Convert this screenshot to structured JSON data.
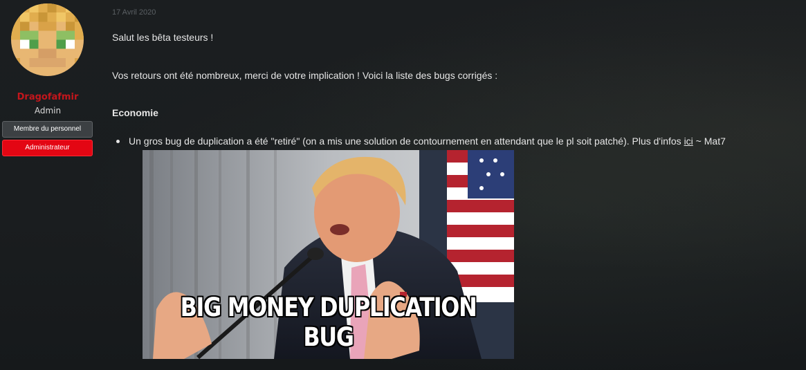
{
  "author": {
    "username": "Dragofafmir",
    "role": "Admin",
    "badges": [
      "Membre du personnel",
      "Administrateur"
    ]
  },
  "post": {
    "date": "17 Avril 2020",
    "greeting": "Salut les bêta testeurs !",
    "intro": "Vos retours ont été nombreux, merci de votre implication ! Voici la liste des bugs corrigés :",
    "section_title": "Economie",
    "bullets": [
      {
        "before": "Un gros bug de duplication a été \"retiré\" (on a mis une solution de contournement en attendant que le pl soit patché). Plus d'infos ",
        "link": "ici",
        "after": " ~ Mat7"
      }
    ],
    "image_caption": "BIG MONEY DUPLICATION BUG"
  },
  "colors": {
    "username": "#c4161c",
    "admin_badge": "#e30613",
    "staff_badge": "#3c4043"
  }
}
